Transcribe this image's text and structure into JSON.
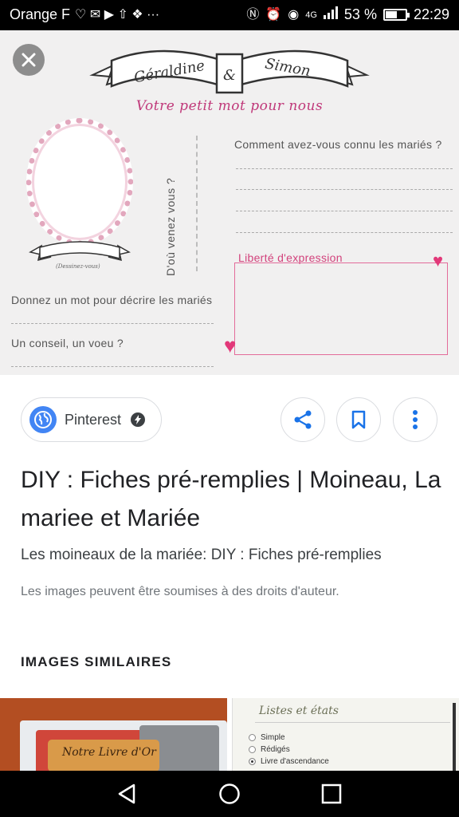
{
  "status_bar": {
    "carrier": "Orange F",
    "notif_glyphs": "♡ ✉ ▶ ⇧ ❖ ···",
    "network": "4G",
    "battery": "53 %",
    "time": "22:29"
  },
  "preview": {
    "names": {
      "left": "Géraldine",
      "amp": "&",
      "right": "Simon"
    },
    "subtitle": "Votre petit mot pour nous",
    "photo_caption": "(Dessinez-vous)",
    "vertical_question": "D'où venez vous ?",
    "question_right": "Comment avez-vous connu les mariés ?",
    "free_label": "Liberté d'expression",
    "question_describe": "Donnez un mot pour décrire les mariés",
    "question_advice": "Un conseil, un voeu ?"
  },
  "source": {
    "name": "Pinterest"
  },
  "title": "DIY : Fiches pré-remplies | Moineau, La mariee et Mariée",
  "snippet": "Les moineaux de la mariée: DIY : Fiches pré-remplies",
  "copyright": "Les images peuvent être soumises à des droits d'auteur.",
  "similar": {
    "heading": "IMAGES SIMILAIRES",
    "thumb1_text": "Notre Livre d'Or",
    "thumb2": {
      "heading": "Listes et états",
      "options": [
        "Simple",
        "Rédigés",
        "Livre d'ascendance"
      ],
      "selected": 2
    }
  },
  "colors": {
    "accent_pink": "#e23879",
    "google_blue": "#4285f4"
  }
}
